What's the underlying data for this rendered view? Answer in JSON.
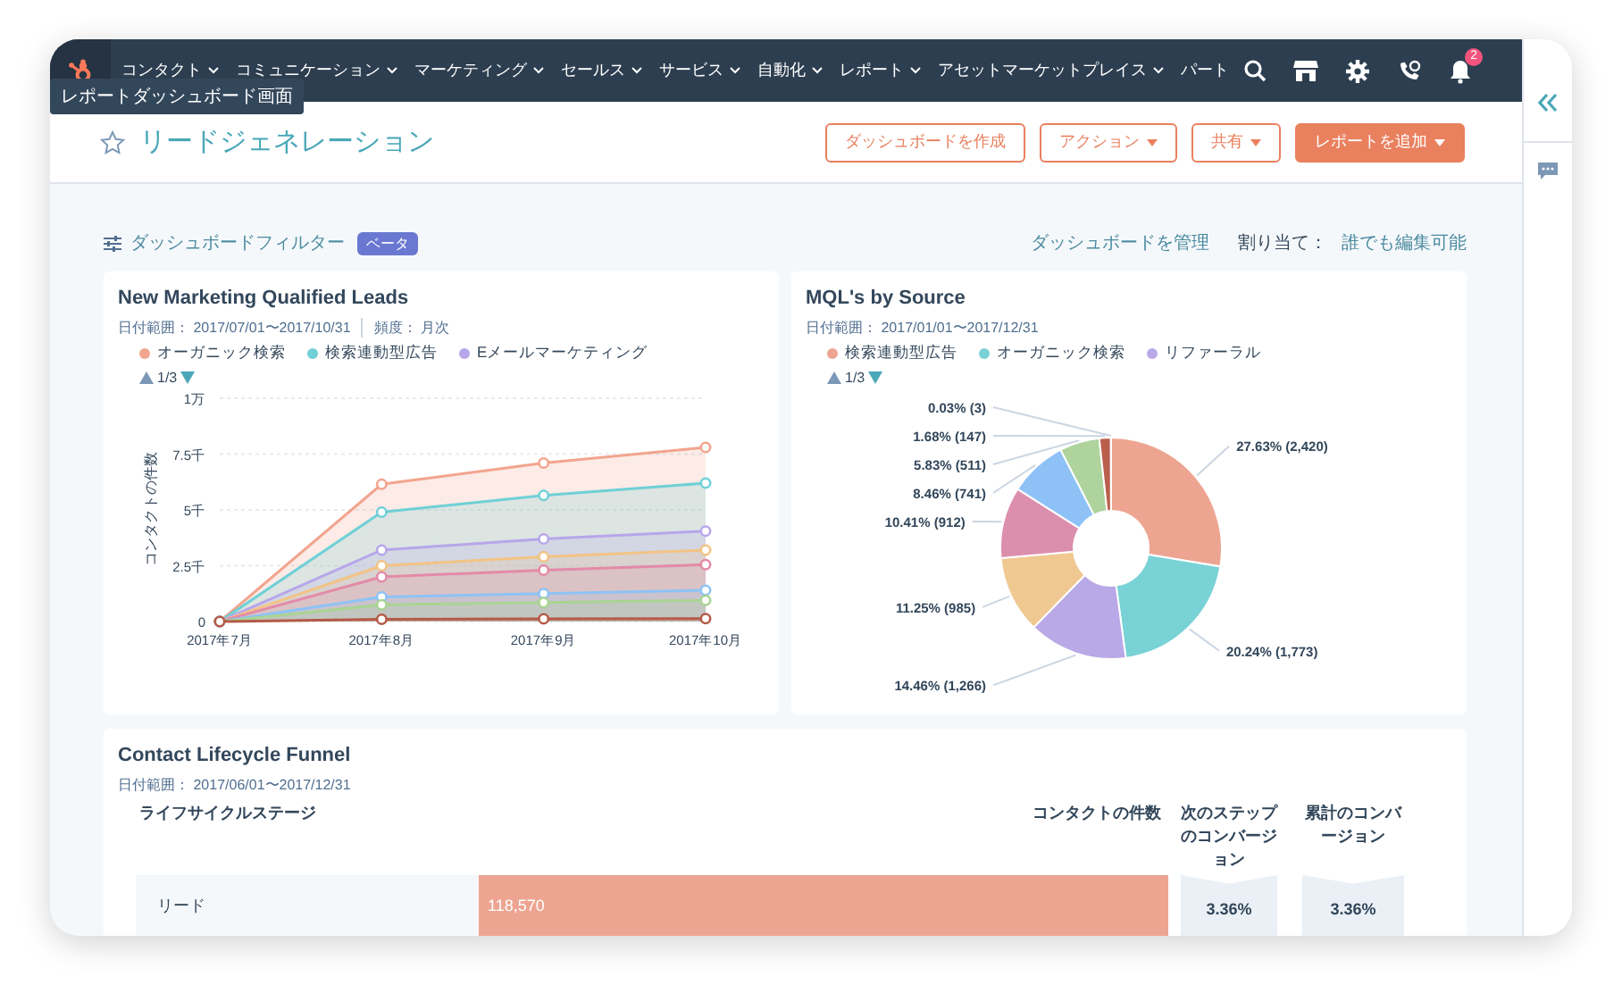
{
  "nav": {
    "items": [
      {
        "label": "コンタクト"
      },
      {
        "label": "コミュニケーション"
      },
      {
        "label": "マーケティング"
      },
      {
        "label": "セールス"
      },
      {
        "label": "サービス"
      },
      {
        "label": "自動化"
      },
      {
        "label": "レポート"
      },
      {
        "label": "アセットマーケットプレイス"
      },
      {
        "label": "パート"
      }
    ],
    "notifications": "2"
  },
  "tooltip": "レポートダッシュボード画面",
  "header": {
    "title": "リードジェネレーション",
    "favorite": false,
    "buttons": [
      {
        "label": "ダッシュボードを作成",
        "kind": "outline",
        "caret": false
      },
      {
        "label": "アクション",
        "kind": "outline",
        "caret": true
      },
      {
        "label": "共有",
        "kind": "outline",
        "caret": true
      },
      {
        "label": "レポートを追加",
        "kind": "primary",
        "caret": true
      }
    ]
  },
  "filter_bar": {
    "label": "ダッシュボードフィルター",
    "badge": "ベータ",
    "manage": "ダッシュボードを管理",
    "assign_label": "割り当て：",
    "assign_value": "誰でも編集可能"
  },
  "line_card": {
    "title": "New Marketing Qualified Leads",
    "date_range": "日付範囲： 2017/07/01〜2017/10/31",
    "frequency": "頻度： 月次",
    "pager": "1/3",
    "y_axis_top_label": "1万",
    "chart_data": {
      "type": "area",
      "ylabel": "コンタクトの件数",
      "x": [
        "2017年7月",
        "2017年8月",
        "2017年9月",
        "2017年10月"
      ],
      "yticks": [
        {
          "value": 0,
          "label": "0"
        },
        {
          "value": 2.5,
          "label": "2.5千"
        },
        {
          "value": 5,
          "label": "5千"
        },
        {
          "value": 7.5,
          "label": "7.5千"
        }
      ],
      "ylim": [
        0,
        10
      ],
      "grid": true,
      "series": [
        {
          "name": "オーガニック検索",
          "color": "#f2a48e",
          "values": [
            0,
            6.15,
            7.1,
            7.8
          ]
        },
        {
          "name": "検索連動型広告",
          "color": "#6fd0d6",
          "values": [
            0,
            4.9,
            5.65,
            6.2
          ]
        },
        {
          "name": "Eメールマーケティング",
          "color": "#b7a6ea",
          "values": [
            0,
            3.2,
            3.7,
            4.05
          ]
        },
        {
          "color": "#f3c384",
          "values": [
            0,
            2.5,
            2.9,
            3.2
          ]
        },
        {
          "color": "#e38aa8",
          "values": [
            0,
            2.0,
            2.3,
            2.55
          ]
        },
        {
          "color": "#8dc3f5",
          "values": [
            0,
            1.1,
            1.25,
            1.4
          ]
        },
        {
          "color": "#a9d492",
          "values": [
            0,
            0.75,
            0.85,
            0.95
          ]
        },
        {
          "color": "#b55a48",
          "values": [
            0,
            0.1,
            0.12,
            0.13
          ]
        }
      ]
    }
  },
  "donut_card": {
    "title": "MQL's by Source",
    "date_range": "日付範囲： 2017/01/01〜2017/12/31",
    "pager": "1/3",
    "legend": [
      {
        "name": "検索連動型広告",
        "color": "#eda591"
      },
      {
        "name": "オーガニック検索",
        "color": "#79d2d6"
      },
      {
        "name": "リファーラル",
        "color": "#b9a9e6"
      }
    ],
    "chart_data": {
      "type": "donut",
      "values": [
        27.63,
        20.24,
        14.46,
        11.25,
        10.41,
        8.46,
        5.83,
        1.68,
        0.03
      ],
      "colors": [
        "#eda591",
        "#79d2d6",
        "#b9a9e6",
        "#f0c892",
        "#dc8fad",
        "#8ec2f7",
        "#aed39d",
        "#b95f4c",
        "#8c4a3a"
      ],
      "value_labels": [
        "27.63% (2,420)",
        "20.24% (1,773)",
        "14.46% (1,266)",
        "11.25% (985)",
        "10.41% (912)",
        "8.46% (741)",
        "5.83% (511)",
        "1.68% (147)",
        "0.03% (3)"
      ]
    }
  },
  "funnel_card": {
    "title": "Contact Lifecycle Funnel",
    "date_range": "日付範囲： 2017/06/01〜2017/12/31",
    "columns": [
      "ライフサイクルステージ",
      "コンタクトの件数",
      "次のステップのコンバージョン",
      "累計のコンバージョン"
    ],
    "rows": [
      {
        "stage": "リード",
        "count": "118,570",
        "level": 1,
        "next": "3.36%",
        "cumulative": "3.36%"
      }
    ]
  }
}
